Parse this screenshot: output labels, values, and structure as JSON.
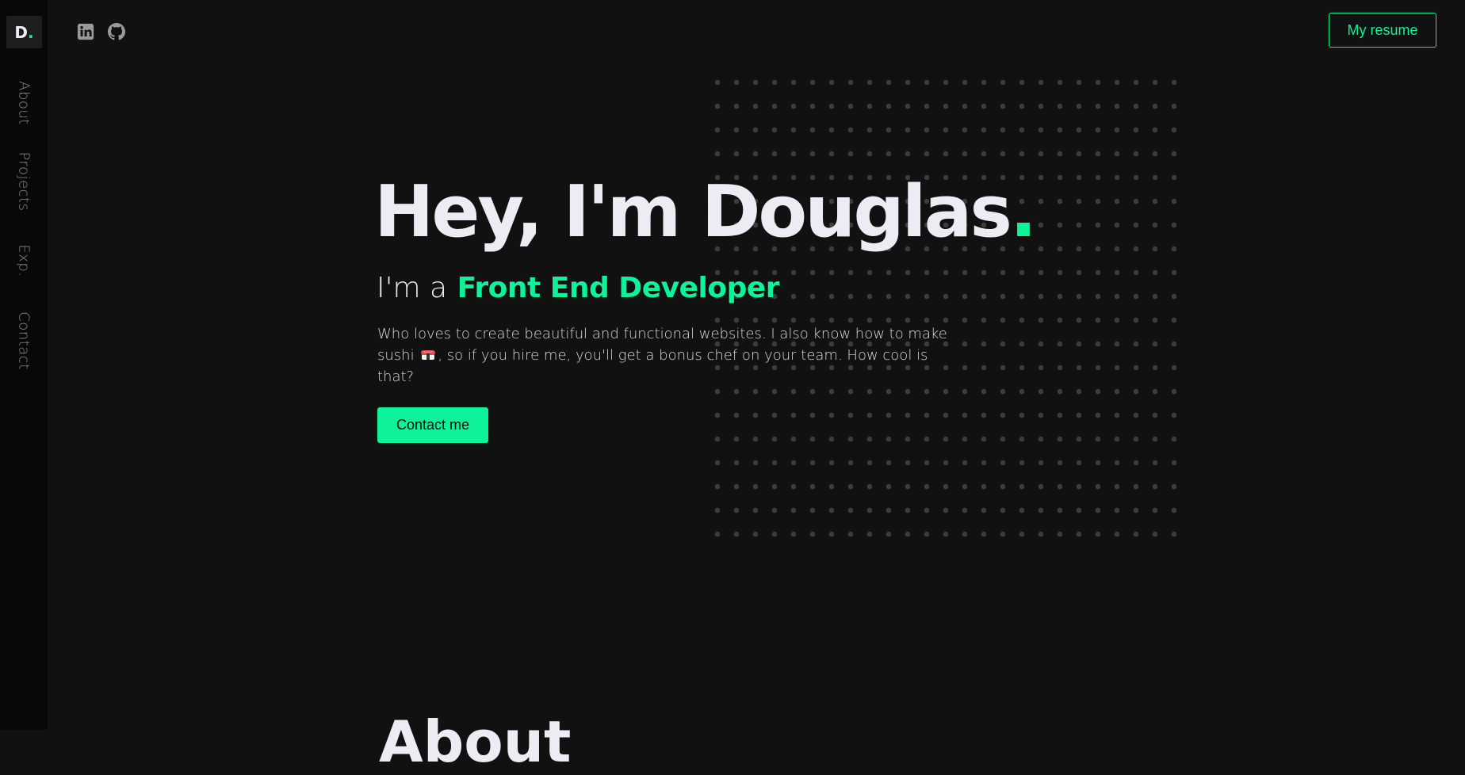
{
  "brand": {
    "logo_letter": "D",
    "logo_dot": ".",
    "accent_color": "#0ef29a"
  },
  "sidebar": {
    "items": [
      {
        "label": "About"
      },
      {
        "label": "Projects"
      },
      {
        "label": "Exp."
      },
      {
        "label": "Contact"
      }
    ]
  },
  "header": {
    "social_icons": [
      "linkedin-icon",
      "github-icon"
    ],
    "resume_label": "My resume"
  },
  "hero": {
    "title": "Hey, I'm Douglas",
    "title_dot": ".",
    "subtitle_lead": "I'm a",
    "subtitle_role": "Front End Developer",
    "intro_part1": "Who loves to create beautiful and functional websites. I also know how to make sushi",
    "intro_icon": "sushi-icon",
    "intro_part2": ", so if you hire me, you'll get a bonus chef on your team. How cool is that?",
    "contact_label": "Contact me"
  },
  "about": {
    "heading": "About"
  }
}
